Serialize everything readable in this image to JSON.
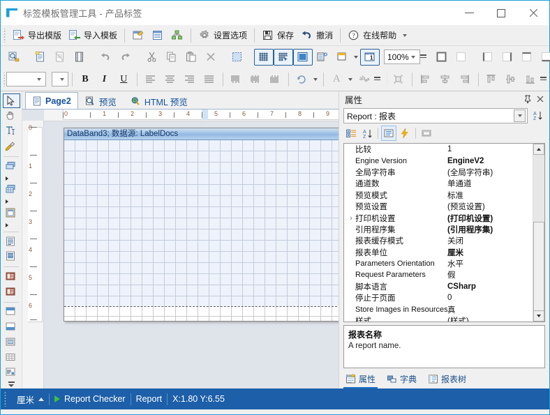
{
  "window": {
    "title": "标签模板管理工具 - 产品标签",
    "logo_icon": "app-logo-icon",
    "minimize": "minimize-button",
    "maximize": "maximize-button",
    "close": "close-button"
  },
  "toolbar_main": {
    "items": [
      {
        "label": "导出模版",
        "icon": "export-template-icon"
      },
      {
        "label": "导入模板",
        "icon": "import-template-icon"
      },
      {
        "label": "",
        "icon": "page-setup-icon"
      },
      {
        "label": "",
        "icon": "report-grid-icon"
      },
      {
        "label": "",
        "icon": "hierarchy-icon"
      },
      {
        "label": "设置选项",
        "icon": "gear-icon"
      },
      {
        "label": "保存",
        "icon": "save-icon"
      },
      {
        "label": "撤消",
        "icon": "undo-icon"
      },
      {
        "label": "在线帮助",
        "icon": "help-circle-icon"
      }
    ],
    "overflow": "toolbar-overflow"
  },
  "toolbar_edit": {
    "items": [
      {
        "icon": "preview-icon",
        "name": "preview-button"
      },
      {
        "icon": "new-page-icon",
        "name": "new-page-button"
      },
      {
        "icon": "delete-page-icon",
        "name": "delete-page-button"
      },
      {
        "icon": "page-setup2-icon",
        "name": "page-setup-button"
      },
      {
        "icon": "undo-icon",
        "name": "undo-button"
      },
      {
        "icon": "redo-icon",
        "name": "redo-button"
      },
      {
        "icon": "cut-icon",
        "name": "cut-button"
      },
      {
        "icon": "copy-icon",
        "name": "copy-button"
      },
      {
        "icon": "paste-icon",
        "name": "paste-button"
      },
      {
        "icon": "delete-x-icon",
        "name": "delete-button"
      },
      {
        "icon": "select-all-icon",
        "name": "select-all-button"
      },
      {
        "icon": "show-grid-icon",
        "name": "show-grid-toggle",
        "active": true
      },
      {
        "icon": "snap-to-grid-icon",
        "name": "align-to-grid-toggle",
        "active": true
      },
      {
        "icon": "show-band-icon",
        "name": "show-bands-toggle",
        "active": true
      },
      {
        "icon": "page-lines-icon",
        "name": "page-lines-button"
      },
      {
        "icon": "page-header-icon",
        "name": "page-header-button"
      },
      {
        "icon": "page-number-icon",
        "name": "page-number-toggle",
        "active": true
      }
    ],
    "zoom": {
      "value": "100%",
      "name": "zoom-combo"
    },
    "style_buttons": [
      {
        "icon": "border-all-icon",
        "name": "border-all-button"
      },
      {
        "icon": "border-none-icon",
        "name": "border-none-button"
      },
      {
        "icon": "border-left-icon",
        "name": "border-left-button"
      },
      {
        "icon": "border-right-icon",
        "name": "border-right-button"
      },
      {
        "icon": "border-top-icon",
        "name": "border-top-button"
      },
      {
        "icon": "border-bottom-icon",
        "name": "border-bottom-button"
      },
      {
        "icon": "shadow-icon",
        "name": "shadow-button"
      }
    ]
  },
  "toolbar_format": {
    "font_family": {
      "value": "",
      "name": "font-family-combo"
    },
    "font_size": {
      "value": "",
      "name": "font-size-combo"
    },
    "bold": "B",
    "italic": "I",
    "underline": "U",
    "align": [
      {
        "icon": "align-left-icon"
      },
      {
        "icon": "align-center-icon"
      },
      {
        "icon": "align-right-icon"
      },
      {
        "icon": "align-justify-icon"
      }
    ],
    "valign": [
      {
        "icon": "valign-top-icon"
      },
      {
        "icon": "valign-middle-icon"
      },
      {
        "icon": "valign-bottom-icon"
      }
    ],
    "rotate": {
      "icon": "text-rotate-icon"
    },
    "font_color": {
      "icon": "font-color-icon",
      "label": "A"
    },
    "highlight": {
      "icon": "highlight-icon"
    },
    "arrange": [
      {
        "icon": "bring-to-front-icon"
      },
      {
        "icon": "align-objects-left-icon"
      },
      {
        "icon": "align-objects-center-icon"
      },
      {
        "icon": "align-objects-right-icon"
      },
      {
        "icon": "align-objects-top-icon"
      },
      {
        "icon": "align-objects-middle-icon"
      },
      {
        "icon": "align-objects-bottom-icon"
      }
    ]
  },
  "vertical_tools": [
    {
      "icon": "select-pointer-icon",
      "name": "tool-select",
      "active": true
    },
    {
      "icon": "hand-pan-icon",
      "name": "tool-hand"
    },
    {
      "icon": "text-edit-icon",
      "name": "tool-text-edit"
    },
    {
      "icon": "format-painter-icon",
      "name": "tool-format-painter"
    },
    {
      "icon": "bands-icon",
      "name": "tool-bands",
      "submenu": true
    },
    {
      "icon": "cross-tab-icon",
      "name": "tool-cross-tab",
      "submenu": true
    },
    {
      "icon": "dialog-icon",
      "name": "tool-dialog",
      "submenu": true
    },
    {
      "icon": "text-box-icon",
      "name": "tool-text-box"
    },
    {
      "icon": "rich-text-icon",
      "name": "tool-rich-text"
    },
    {
      "icon": "sys-text-icon",
      "name": "tool-system-text"
    },
    {
      "icon": "sys-text2-icon",
      "name": "tool-system-text2"
    },
    {
      "icon": "header-band-icon",
      "name": "tool-header-band"
    },
    {
      "icon": "footer-band-icon",
      "name": "tool-footer-band"
    },
    {
      "icon": "panel-icon",
      "name": "tool-panel"
    },
    {
      "icon": "table-icon",
      "name": "tool-table"
    },
    {
      "icon": "barcode-icon",
      "name": "tool-barcode"
    }
  ],
  "tabs": [
    {
      "label": "Page2",
      "icon": "page-icon",
      "active": true
    },
    {
      "label": "预览",
      "icon": "preview-tab-icon",
      "active": false
    },
    {
      "label": "HTML 预览",
      "icon": "html-preview-icon",
      "active": false
    }
  ],
  "canvas": {
    "band_title": "DataBand3; 数据源: LabelDocs",
    "h_ruler_ticks": [
      "0",
      "1",
      "2",
      "3",
      "4",
      "5",
      "6",
      "7",
      "8",
      "9"
    ],
    "v_ruler_ticks": [
      "0",
      "1",
      "2",
      "3",
      "4",
      "5",
      "6"
    ]
  },
  "properties": {
    "panel_title": "属性",
    "pin_icon": "pin-icon",
    "close_icon": "close-icon",
    "object_selector": "Report : 报表",
    "sort_az_icon": "sort-alpha-icon",
    "tool_buttons": [
      {
        "icon": "categorized-icon",
        "name": "categorized-button"
      },
      {
        "icon": "alphabetical-icon",
        "name": "alphabetical-button"
      },
      {
        "icon": "properties-list-icon",
        "name": "properties-button",
        "active": true
      },
      {
        "icon": "events-lightning-icon",
        "name": "events-button"
      },
      {
        "icon": "property-pages-icon",
        "name": "property-pages-button"
      }
    ],
    "rows": [
      {
        "name": "比较",
        "value": "1",
        "bold": false,
        "en": false,
        "expand": false
      },
      {
        "name": "Engine Version",
        "value": "EngineV2",
        "bold": true,
        "en": true,
        "expand": false
      },
      {
        "name": "全局字符串",
        "value": "(全局字符串)",
        "bold": false,
        "en": false,
        "expand": false
      },
      {
        "name": "通道数",
        "value": "单通道",
        "bold": false,
        "en": false,
        "expand": false
      },
      {
        "name": "预览模式",
        "value": "标准",
        "bold": false,
        "en": false,
        "expand": false
      },
      {
        "name": "预览设置",
        "value": "(预览设置)",
        "bold": false,
        "en": false,
        "expand": false
      },
      {
        "name": "打印机设置",
        "value": "(打印机设置)",
        "bold": true,
        "en": false,
        "expand": true
      },
      {
        "name": "引用程序集",
        "value": "(引用程序集)",
        "bold": true,
        "en": false,
        "expand": false
      },
      {
        "name": "报表缓存模式",
        "value": "关闭",
        "bold": false,
        "en": false,
        "expand": false
      },
      {
        "name": "报表单位",
        "value": "厘米",
        "bold": true,
        "en": false,
        "expand": false
      },
      {
        "name": "Parameters Orientation",
        "value": "水平",
        "bold": false,
        "en": true,
        "expand": false
      },
      {
        "name": "Request Parameters",
        "value": "假",
        "bold": false,
        "en": true,
        "expand": false
      },
      {
        "name": "脚本语言",
        "value": "CSharp",
        "bold": true,
        "en": false,
        "expand": false
      },
      {
        "name": "停止于页面",
        "value": "0",
        "bold": false,
        "en": false,
        "expand": false
      },
      {
        "name": "Store Images in Resources",
        "value": "真",
        "bold": false,
        "en": true,
        "expand": false
      },
      {
        "name": "样式",
        "value": "(样式)",
        "bold": false,
        "en": false,
        "expand": false
      }
    ],
    "description": {
      "title": "报表名称",
      "text": "A report name."
    },
    "bottom_tabs": [
      {
        "label": "属性",
        "icon": "properties-tab-icon",
        "active": true
      },
      {
        "label": "字典",
        "icon": "dictionary-tab-icon",
        "active": false
      },
      {
        "label": "报表树",
        "icon": "report-tree-tab-icon",
        "active": false
      }
    ]
  },
  "status_bar": {
    "unit": "厘米",
    "unit_caret": "up-caret-icon",
    "checker_icon": "run-checker-icon",
    "checker": "Report Checker",
    "object": "Report",
    "coords": "X:1.80  Y:6.55"
  },
  "colors": {
    "accent": "#1d5fa8",
    "titlebar_border": "#1c9fd8",
    "band_blue": "#9dc0e4",
    "link": "#14539a"
  }
}
